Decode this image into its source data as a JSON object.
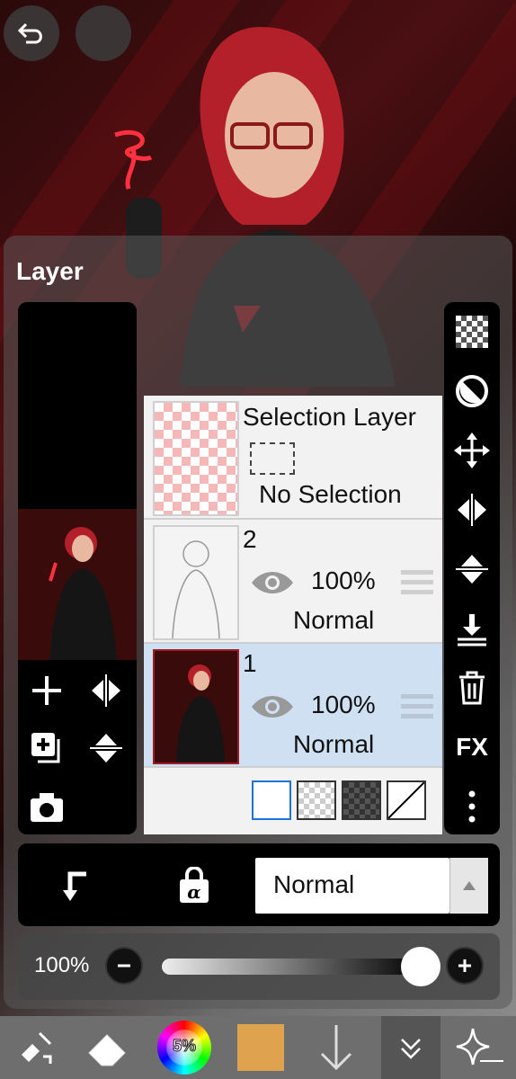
{
  "panel": {
    "title": "Layer"
  },
  "layers": [
    {
      "name": "Selection Layer",
      "status": "No Selection"
    },
    {
      "name": "2",
      "opacity": "100%",
      "blend": "Normal"
    },
    {
      "name": "1",
      "opacity": "100%",
      "blend": "Normal"
    }
  ],
  "right_tools": {
    "fx_label": "FX"
  },
  "blend_mode": {
    "selected": "Normal"
  },
  "opacity": {
    "label": "100%",
    "value": 1.0
  },
  "toolbar": {
    "color_wheel_label": "5%"
  },
  "colors": {
    "selected_row": "#cfe0f2",
    "current_color": "#dfa24f",
    "accent": "#1e73d8"
  }
}
